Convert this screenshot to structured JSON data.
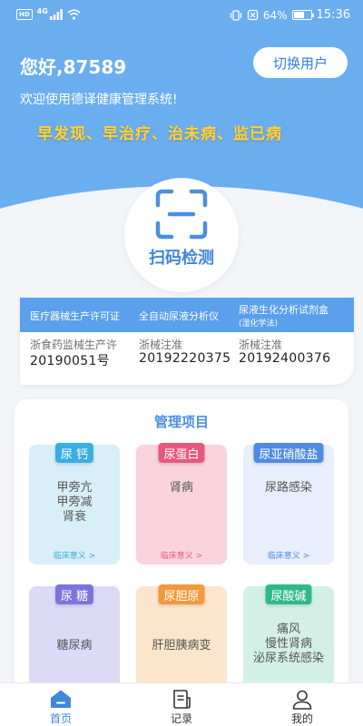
{
  "status_bar": {
    "hd_badge": "HD",
    "network": "4G",
    "battery": "64%",
    "battery_level": 0.64,
    "time": "15:36"
  },
  "header": {
    "greeting": "您好,87589",
    "switch_user_label": "切换用户",
    "welcome": "欢迎使用德译健康管理系统!",
    "slogan": "早发现、早治疗、治未病、监已病"
  },
  "scan": {
    "label": "扫码检测",
    "icon": "scan-icon"
  },
  "certificates": [
    {
      "title": "医疗器械生产许可证",
      "subtitle": "",
      "issuer": "浙食药监械生产许",
      "number": "20190051号"
    },
    {
      "title": "全自动尿液分析仪",
      "subtitle": "",
      "issuer": "浙械注准",
      "number": "20192220375"
    },
    {
      "title": "尿液生化分析试剂盒",
      "subtitle": "(湿化学法)",
      "issuer": "浙械注准",
      "number": "20192400376"
    }
  ],
  "management": {
    "title": "管理项目",
    "more_label": "临床意义 >",
    "items": [
      {
        "tag": "尿 钙",
        "lines": [
          "甲旁亢",
          "甲旁减",
          "肾衰"
        ],
        "bg": "#d8eef8",
        "tag_color": "#3aaee0",
        "more_color": "#3aaee0"
      },
      {
        "tag": "尿蛋白",
        "lines": [
          "肾病"
        ],
        "bg": "#f9d4dd",
        "tag_color": "#e9587c",
        "more_color": "#e9587c"
      },
      {
        "tag": "尿亚硝酸盐",
        "lines": [
          "尿路感染"
        ],
        "bg": "#e8eefb",
        "tag_color": "#4f8be0",
        "more_color": "#4f8be0"
      },
      {
        "tag": "尿 糖",
        "lines": [
          "糖尿病"
        ],
        "bg": "#dcdaf6",
        "tag_color": "#7c74dc",
        "more_color": "#7c74dc"
      },
      {
        "tag": "尿胆原",
        "lines": [
          "肝胆胰病变"
        ],
        "bg": "#fbe5cc",
        "tag_color": "#f19a3c",
        "more_color": "#f19a3c"
      },
      {
        "tag": "尿酸碱",
        "lines": [
          "痛风",
          "慢性肾病",
          "泌尿系统感染"
        ],
        "bg": "#d4f0e6",
        "tag_color": "#2fb98a",
        "more_color": "#2fb98a"
      }
    ]
  },
  "tabs": [
    {
      "label": "首页",
      "icon": "home-icon",
      "active": true
    },
    {
      "label": "记录",
      "icon": "records-icon",
      "active": false
    },
    {
      "label": "我的",
      "icon": "profile-icon",
      "active": false
    }
  ],
  "colors": {
    "primary": "#5aa0ec",
    "slogan": "#ffd236",
    "active_tab": "#3f87db",
    "inactive_tab": "#333333"
  }
}
